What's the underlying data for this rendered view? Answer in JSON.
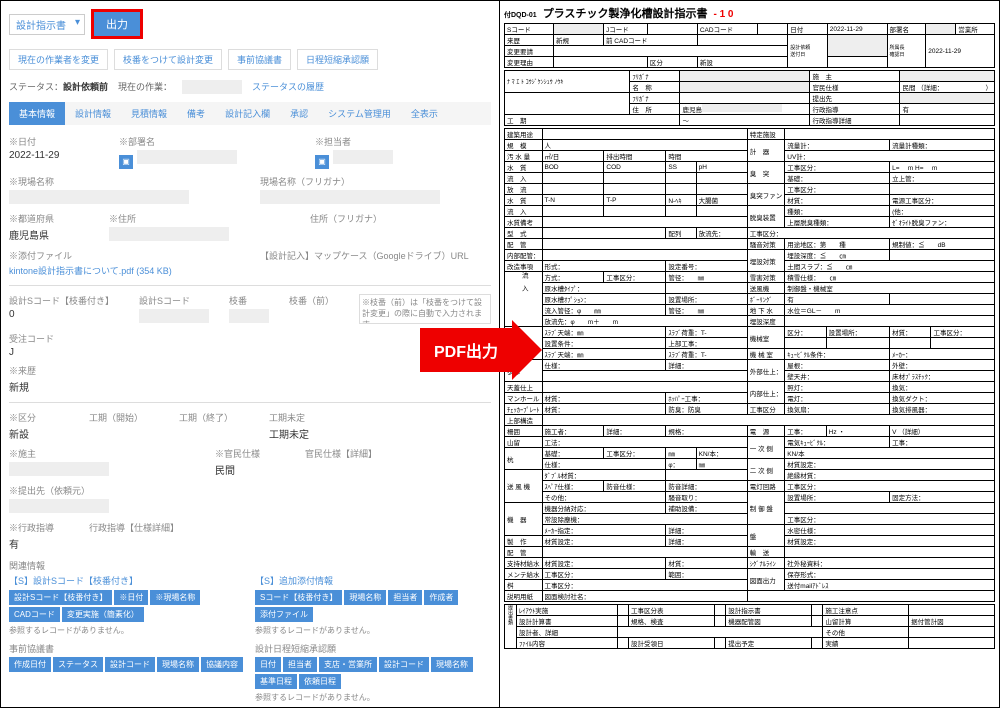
{
  "topBar": {
    "dropdown": "設計指示書",
    "outputBtn": "出力"
  },
  "actionButtons": [
    "現在の作業者を変更",
    "枝番をつけて設計変更",
    "事前協議書",
    "日程短縮承認願"
  ],
  "status": {
    "label": "ステータス：",
    "value": "設計依頼前",
    "workerLabel": "現在の作業：",
    "worker": "",
    "historyLink": "ステータスの履歴"
  },
  "tabs": [
    "基本情報",
    "設計情報",
    "見積情報",
    "備考",
    "設計記入欄",
    "承認",
    "システム管理用",
    "全表示"
  ],
  "form": {
    "dateLabel": "※日付",
    "date": "2022-11-29",
    "deptLabel": "※部署名",
    "assigneeLabel": "※担当者",
    "siteNameLabel": "※現場名称",
    "siteNameKanaLabel": "現場名称（フリガナ）",
    "prefLabel": "※都道府県",
    "pref": "鹿児島県",
    "addressLabel": "※住所",
    "addressKanaLabel": "住所（フリガナ）",
    "attachLabel": "※添付ファイル",
    "attachFile": "kintone設計指示書について.pdf (354 KB)",
    "mapLabel": "【設計記入】マップケース（Googleドライブ）URL",
    "sCodeBranchLabel": "設計Sコード【枝番付き】",
    "sCodeBranch": "0",
    "sCodeLabel": "設計Sコード",
    "branchLabel": "枝番",
    "branchPrevLabel": "枝番（前）",
    "noteText": "※枝番（前）は「枝番をつけて設計変更」の際に自動で入力されます。\n新規作成時は入力不要です。\n他物件を複製して新規作成した場合、枝番（前）を削除してください。",
    "orderCodeLabel": "受注コード",
    "orderCode": "J",
    "historyLabel": "※来歴",
    "history": "新規",
    "categoryLabel": "※区分",
    "category": "新設",
    "periodStartLabel": "工期（開始）",
    "periodEndLabel": "工期（終了）",
    "periodUndecidedLabel": "工期未定",
    "periodUndecided": "工期未定",
    "builderLabel": "※施主",
    "specLabel": "※官民仕様",
    "spec": "民間",
    "specDetailLabel": "官民仕様【詳細】",
    "submitLabel": "※提出先（依頼元）",
    "adminLabel": "※行政指導",
    "admin": "有",
    "adminDetailLabel": "行政指導【仕様詳細】"
  },
  "related": {
    "title": "関連情報",
    "leftTitle": "【S】設計Sコード【枝番付き】",
    "leftTags": [
      "設計Sコード【枝番付き】",
      "※日付",
      "※現場名称",
      "CADコード",
      "変更実施（簡素化）"
    ],
    "rightTitle": "【S】追加添付情報",
    "rightTags": [
      "Sコード【枝番付き】",
      "現場名称",
      "担当者",
      "作成者",
      "添付ファイル"
    ],
    "noRecords": "参照するレコードがありません。",
    "section2Left": "事前協議書",
    "section2LeftTags": [
      "作成日付",
      "ステータス",
      "設計コード",
      "現場名称",
      "協議内容"
    ],
    "section2Right": "設計日程短縮承認願",
    "section2RightTags": [
      "日付",
      "担当者",
      "支店・営業所",
      "設計コード",
      "現場名称",
      "基準日程",
      "依頼日程"
    ]
  },
  "arrow": "PDF出力",
  "pdf": {
    "formId": "付DQD-01",
    "title": "プラスチック製浄化槽設計指示書",
    "rev": "- 1 0",
    "header": {
      "sCode": "Sコード",
      "jCode": "Jコード",
      "cadCode": "CADコード",
      "dateLabel": "日付",
      "date": "2022-11-29",
      "deptLabel": "部署名",
      "dept": "営業所",
      "history": "来歴",
      "historyVal": "新規",
      "prevCad": "前 CADコード",
      "changer": "変更要請",
      "changeReason": "変更理由",
      "category": "区分",
      "categoryVal": "新設",
      "sendDateLabel": "",
      "sendDate": "2022-11-29"
    },
    "name": {
      "furiganaLabel": "ﾌﾘｶﾞﾅ",
      "nameLabel": "名　称",
      "constructorLabel": "施　主",
      "specLabel": "官民仕様",
      "specVal": "民間 （詳細：　　　　　　　）",
      "submitLabel": "提出先"
    },
    "address": {
      "furiganaLabel": "ﾌﾘｶﾞﾅ",
      "addressLabel": "住　所",
      "pref": "鹿児島",
      "adminLabel": "行政指導",
      "adminVal": "有",
      "adminDetailLabel": "行政指導詳細"
    },
    "period": {
      "label": "工　期",
      "tilde": "～"
    },
    "rows": {
      "buildingUse": "建築用途",
      "special": "特定施設",
      "instrument": "計　器",
      "flowMeter": "流量計：",
      "flowType": "流量計種類：",
      "scale": "規　模",
      "person": "人",
      "uv": "UV計：",
      "sewage": "汚 水 量",
      "sewageUnit": "㎥/日",
      "dischargeTime": "排出時間",
      "hour": "時間",
      "quality": "水　質",
      "bod": "BOD",
      "cod": "COD",
      "ss": "SS",
      "ph": "pH",
      "chimney": "臭　突",
      "workCat": "工事区分：",
      "lwh": "L= 　m  H= 　m",
      "inflow": "流　入",
      "foundation": "基礎：",
      "standup": "立上管：",
      "effluent": "放　流",
      "deodorFan": "臭突ファン",
      "material": "材質：",
      "fanWork": "電源工事区分：",
      "quality2": "水　質",
      "tn": "T-N",
      "tp": "T-P",
      "nhex": "N-ﾍｷ",
      "coliform": "大腸菌",
      "type2": "種類：",
      "other": "(他：",
      "deodorDevice": "脱臭装置",
      "upperDeodor": "上層脱臭種類：",
      "zeolite": "ｾﾞｵﾗｲﾄ脱臭ファン：",
      "waterNote": "水質備考",
      "format": "型　式",
      "layout": "配列",
      "riverDischarge": "放流先：",
      "noiseControl": "騒音対策",
      "area": "用途地区：第　　種",
      "limit": "規制値：≦　　dB",
      "piping": "配　管",
      "burial": "埋設対策",
      "depth": "埋設深度：≦　　㎝",
      "internal": "内部配管：",
      "slab": "土間スラブ：≦　　㎝",
      "modItem": "改造事項",
      "formatCol": "形式：",
      "setNum": "設定番号：",
      "snowCover": "雪害対策",
      "snowHeight": "積雪仕様：　　㎝",
      "method": "方式：",
      "pipeSize": "管径：　　㎜",
      "diversion": "送風機",
      "controlType": "制御盤・機械室",
      "pumpType": "原水槽ﾀｲﾌﾟ：",
      "pumpOption": "原水槽ｵﾌﾟｼｮﾝ：",
      "setPlace": "設置場所：",
      "boring": "ﾎﾞｰﾘﾝｸﾞ",
      "inletPipe": "流入管径：φ　　㎜",
      "underground": "地 下 水",
      "wl": "水位＝GL－　　m",
      "dischargeWay": "放流先：φ　　m＋　　m",
      "buriedCond": "埋設深度",
      "tank": "槽",
      "slabTop": "ｽﾗﾌﾞ天端：㎜",
      "slabLoad": "ｽﾗﾌﾞ荷重：T-",
      "machineRoom": "機械室",
      "roomCat": "区分：",
      "placeLabel": "設置場所：",
      "matLabel": "材質：",
      "workCatLabel": "工事区分：",
      "setCond": "設置条件：",
      "upperWork": "上部工事：",
      "machineRoom2": "機 械 室",
      "cubicle": "ｷｭｰﾋﾞｸﾙ条件：",
      "maker": "ﾒｰｶｰ：",
      "slabTop2": "ｽﾗﾌﾞ天端：㎜",
      "slabLoad2": "ｽﾗﾌﾞ荷重：T-",
      "outerWork": "外部仕上：",
      "wall": "屋根：",
      "outerWall": "外壁：",
      "step": "歩廊",
      "spec2": "仕様：",
      "detail": "詳細：",
      "innerWork": "内部仕上：",
      "dkt": "壁天井：",
      "innerFloor": "床材ﾌﾟﾗｽﾁｯｸ：",
      "fence": "天蓋仕上",
      "lighting": "照灯：",
      "ventilation": "換気：",
      "manhole": "マンホール",
      "mhMat": "材質：",
      "mhWork": "ﾎｯﾊﾟｰ工事：",
      "workCat2": "工事区分",
      "light": "電灯：",
      "duct": "換気ダクト：",
      "checker": "ﾁｪｯｶｰﾌﾟﾚｰﾄ",
      "ckMat": "材質：",
      "deodor2": "防臭：防臭",
      "vent2": "換気扇：",
      "ventPipe": "換気排風器：",
      "upperStruct": "上部構造",
      "fenceRow": "柵囲",
      "constructor2": "施工者：",
      "detail2": "詳細：",
      "detail3": "規格：",
      "power": "電　源",
      "work3": "工事：",
      "hz": "Hz ・",
      "v": "V （詳細）",
      "gable": "山留",
      "method2": "工法：",
      "primary": "一 次 側",
      "elecCubicle": "電気ｷｭｰﾋﾞｸﾙ：",
      "work4": "工事：",
      "pile": "杭",
      "base": "基礎：",
      "workCat3": "工事区分：",
      "kn1": "㎜",
      "kn2": "KN/本：",
      "kn3": "KN/本",
      "secondary": "二 次 側",
      "matSet": "材質設定：",
      "blower": "送 風 機",
      "spec3": "仕様：",
      "dbSpec": "φ：",
      "spec4": "ﾀﾞﾌﾞﾙ材質：",
      "insulation": "絶縁材質：",
      "spare": "ｽﾍﾟｱ仕様：",
      "noiseProof": "防音仕様：",
      "noiseDetail": "防音詳細：",
      "lampLine": "電灯回路",
      "workCat4": "工事区分：",
      "others": "その他：",
      "noisePlug": "騒音取り：",
      "machine": "機　器",
      "sepOp": "機器分納対応：",
      "sepWork": "補助設備：",
      "controlPanel": "制 御 盤",
      "placeLabel2": "設置場所：",
      "fixMethod": "固定方法：",
      "spareSet": "常設除塵機：",
      "meterSpec": "ﾒｰｶｰ指定：",
      "detail4": "詳細：",
      "workCat5": "工事区分：",
      "manufacture": "製　作",
      "matSet2": "材質設定：",
      "detail5": "詳細：",
      "matSet3": "材質設定：",
      "piping2": "配　管",
      "panel": "盤",
      "hardwired": "水密仕様：",
      "transport": "輸　送",
      "support": "支持材給水",
      "matSet4": "材質設定：",
      "mat2": "材質：",
      "signalLine": "ｼｸﾞﾅﾙﾗｲﾝ",
      "extSecret": "社外秘資料：",
      "maint": "メンテ給水",
      "workCat6": "工事区分：",
      "range": "範囲：",
      "sheet": "桝",
      "workCat7": "工事区分：",
      "drawingOut": "図面出力",
      "storage": "保存形式：",
      "sendMail": "送付mailｱﾄﾞﾚｽ",
      "desc": "説明用紙",
      "printer": "図面検討社名："
    },
    "footer": {
      "recvDate": "ﾚｲｱｳﾄ実施",
      "leaderCheck": "工事区分表",
      "recvCheck": "設計指示書",
      "designCalc": "施工注意点",
      "designCheck": "設計計算書",
      "specCheck": "規格、検査",
      "design": "機器配管図",
      "sectionCheck": "山留計算",
      "approvalCheck": "据付管計図",
      "designReview": "設計者、詳細",
      "otherRow": "その他",
      "quoteCheck": "ﾌｧｲﾙ内容",
      "recvDate2": "設計受領日",
      "designer": "提出予定",
      "actual": "実績"
    }
  }
}
